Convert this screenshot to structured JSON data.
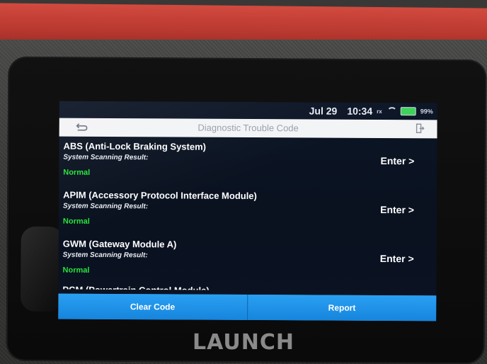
{
  "status_bar": {
    "date": "Jul 29",
    "time": "10:34",
    "signal": "rx",
    "battery_percent": "99%",
    "icons": [
      "wifi-icon",
      "battery-icon"
    ]
  },
  "header": {
    "title": "Diagnostic Trouble Code",
    "back_icon": "back-arrow-icon",
    "exit_icon": "exit-icon"
  },
  "systems": [
    {
      "name": "ABS (Anti-Lock Braking System)",
      "subtitle": "System Scanning Result:",
      "result": "Normal",
      "action": "Enter >"
    },
    {
      "name": "APIM (Accessory Protocol Interface Module)",
      "subtitle": "System Scanning Result:",
      "result": "Normal",
      "action": "Enter >"
    },
    {
      "name": "GWM (Gateway Module A)",
      "subtitle": "System Scanning Result:",
      "result": "Normal",
      "action": "Enter >"
    },
    {
      "name": "PCM (Powertrain Control Module)"
    }
  ],
  "footer": {
    "clear_label": "Clear Code",
    "report_label": "Report"
  },
  "device": {
    "brand": "LAUNCH"
  },
  "colors": {
    "result_normal": "#27e339",
    "button_blue": "#1f8fe6",
    "bumper_red": "#c03a31"
  }
}
